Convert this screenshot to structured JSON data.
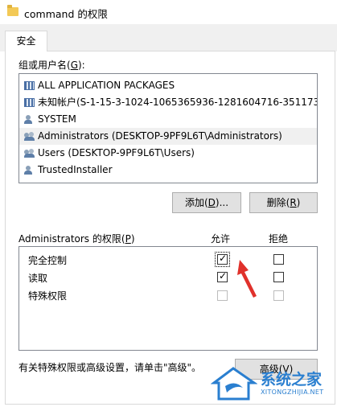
{
  "window": {
    "title": "command 的权限"
  },
  "tabs": [
    {
      "label": "安全"
    }
  ],
  "users_section": {
    "label_prefix": "组或用户名(",
    "label_key": "G",
    "label_suffix": "):",
    "items": [
      {
        "name": "ALL APPLICATION PACKAGES",
        "icon": "package-grid-icon"
      },
      {
        "name": "未知帐户(S-1-15-3-1024-1065365936-1281604716-351173...",
        "icon": "package-grid-icon"
      },
      {
        "name": "SYSTEM",
        "icon": "user-icon"
      },
      {
        "name": "Administrators (DESKTOP-9PF9L6T\\Administrators)",
        "icon": "group-icon",
        "selected": true
      },
      {
        "name": "Users (DESKTOP-9PF9L6T\\Users)",
        "icon": "group-icon"
      },
      {
        "name": "TrustedInstaller",
        "icon": "user-icon"
      }
    ]
  },
  "buttons": {
    "add": {
      "prefix": "添加(",
      "key": "D",
      "suffix": ")..."
    },
    "remove": {
      "prefix": "删除(",
      "key": "R",
      "suffix": ")"
    },
    "advanced": "高级(V)"
  },
  "permissions": {
    "header_prefix": "Administrators 的权限(",
    "header_key": "P",
    "header_suffix": ")",
    "allow_label": "允许",
    "deny_label": "拒绝",
    "rows": [
      {
        "label": "完全控制",
        "allow": true,
        "deny": false,
        "disabled": false
      },
      {
        "label": "读取",
        "allow": true,
        "deny": false,
        "disabled": false
      },
      {
        "label": "特殊权限",
        "allow": false,
        "deny": false,
        "disabled": true
      }
    ]
  },
  "footer_text": "有关特殊权限或高级设置，请单击\"高级\"。",
  "watermark": {
    "name": "系统之家",
    "url": "XITONGZHIJIA.NET"
  },
  "colors": {
    "arrow": "#e0312b",
    "watermark": "#2a7fd0",
    "selection": "#f0f0f0"
  }
}
